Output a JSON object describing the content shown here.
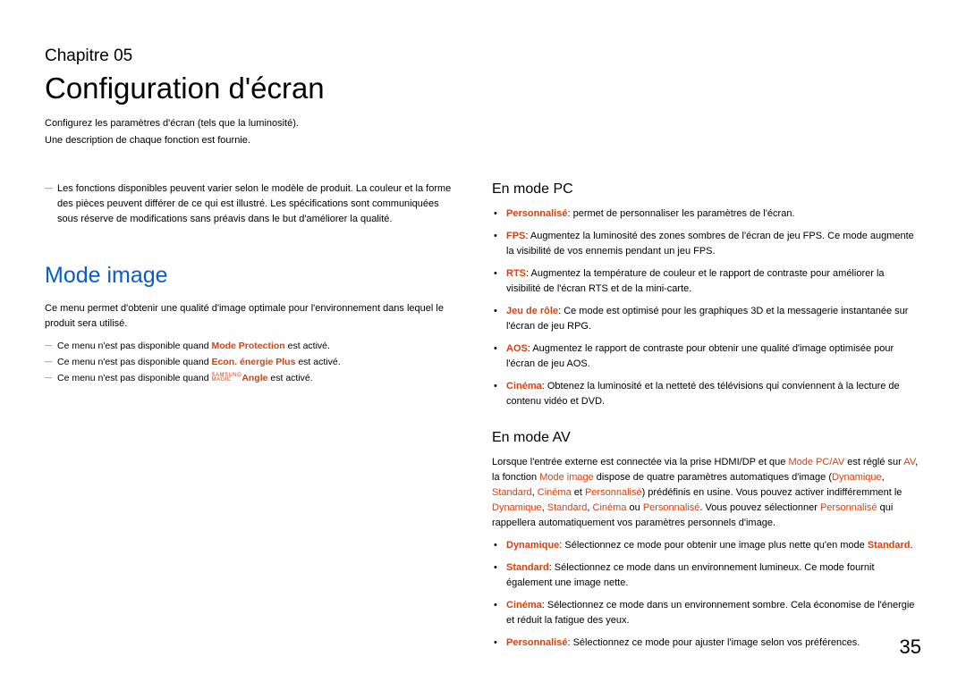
{
  "chapter": {
    "label": "Chapitre 05",
    "title": "Configuration d'écran",
    "desc1": "Configurez les paramètres d'écran (tels que la luminosité).",
    "desc2": "Une description de chaque fonction est fournie."
  },
  "left": {
    "top_note": "Les fonctions disponibles peuvent varier selon le modèle de produit. La couleur et la forme des pièces peuvent différer de ce qui est illustré. Les spécifications sont communiquées sous réserve de modifications sans préavis dans le but d'améliorer la qualité.",
    "heading": "Mode image",
    "body": "Ce menu permet d'obtenir une qualité d'image optimale pour l'environnement dans lequel le produit sera utilisé.",
    "note1_pre": "Ce menu n'est pas disponible quand ",
    "note1_hl": "Mode Protection",
    "note1_post": " est activé.",
    "note2_pre": "Ce menu n'est pas disponible quand ",
    "note2_hl": "Econ. énergie Plus",
    "note2_post": " est activé.",
    "note3_pre": "Ce menu n'est pas disponible quand ",
    "note3_brand_top": "SAMSUNG",
    "note3_brand_bot": "MAGIC",
    "note3_hl": "Angle",
    "note3_post": " est activé."
  },
  "right": {
    "pc_heading": "En mode PC",
    "pc_items": {
      "i0_hl": "Personnalisé",
      "i0_txt": ": permet de personnaliser les paramètres de l'écran.",
      "i1_hl": "FPS",
      "i1_txt": ": Augmentez la luminosité des zones sombres de l'écran de jeu FPS. Ce mode augmente la visibilité de vos ennemis pendant un jeu FPS.",
      "i2_hl": "RTS",
      "i2_txt": ": Augmentez la température de couleur et le rapport de contraste pour améliorer la visibilité de l'écran RTS et de la mini-carte.",
      "i3_hl": "Jeu de rôle",
      "i3_txt": ": Ce mode est optimisé pour les graphiques 3D et la messagerie instantanée sur l'écran de jeu RPG.",
      "i4_hl": "AOS",
      "i4_txt": ": Augmentez le rapport de contraste pour obtenir une qualité d'image optimisée pour l'écran de jeu AOS.",
      "i5_hl": "Cinéma",
      "i5_txt": ": Obtenez la luminosité et la netteté des télévisions qui conviennent à la lecture de contenu vidéo et DVD."
    },
    "av_heading": "En mode AV",
    "av_intro": {
      "p1": "Lorsque l'entrée externe est connectée via la prise HDMI/DP et que ",
      "p1h1": "Mode PC/AV",
      "p2": " est réglé sur ",
      "p2h1": "AV",
      "p3": ", la fonction ",
      "p3h1": "Mode image",
      "p4": " dispose de quatre paramètres automatiques d'image (",
      "p4h1": "Dynamique",
      "p5": ", ",
      "p5h1": "Standard",
      "p6": ", ",
      "p6h1": "Cinéma",
      "p7": " et ",
      "p7h1": "Personnalisé",
      "p8": ") prédéfinis en usine. Vous pouvez activer indifféremment le ",
      "p8h1": "Dynamique",
      "p9": ", ",
      "p9h1": "Standard",
      "p10": ", ",
      "p10h1": "Cinéma",
      "p11": " ou ",
      "p11h1": "Personnalisé",
      "p12": ". Vous pouvez sélectionner ",
      "p12h1": "Personnalisé",
      "p13": " qui rappellera automatiquement vos paramètres personnels d'image."
    },
    "av_items": {
      "i0_hl": "Dynamique",
      "i0_txt1": ": Sélectionnez ce mode pour obtenir une image plus nette qu'en mode ",
      "i0_hl2": "Standard",
      "i0_txt2": ".",
      "i1_hl": "Standard",
      "i1_txt": ": Sélectionnez ce mode dans un environnement lumineux. Ce mode fournit également une image nette.",
      "i2_hl": "Cinéma",
      "i2_txt": ": Sélectionnez ce mode dans un environnement sombre. Cela économise de l'énergie et réduit la fatigue des yeux.",
      "i3_hl": "Personnalisé",
      "i3_txt": ": Sélectionnez ce mode pour ajuster l'image selon vos préférences."
    }
  },
  "page_number": "35"
}
